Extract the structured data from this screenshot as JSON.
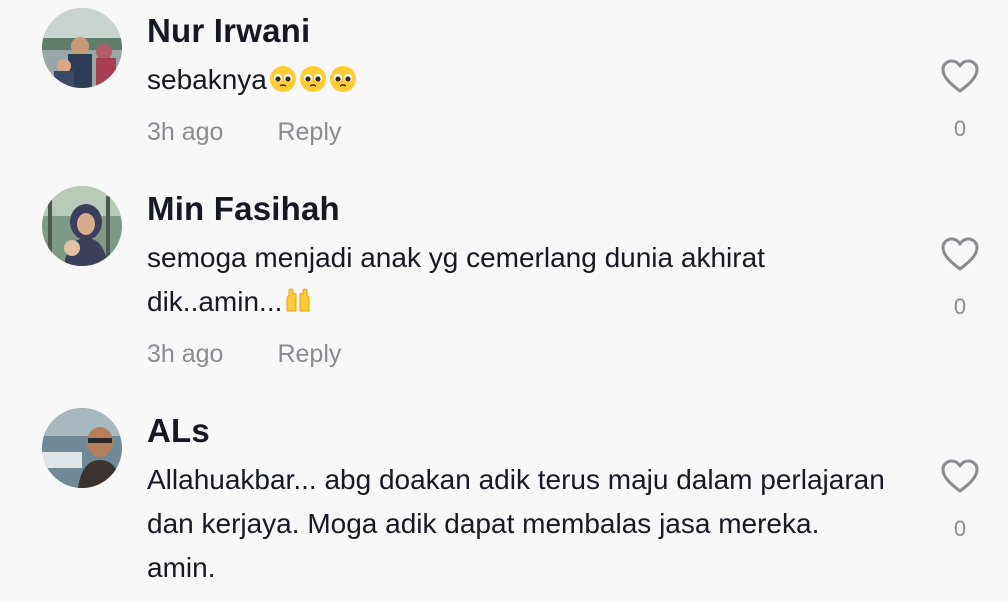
{
  "comments": [
    {
      "username": "Nur Irwani",
      "text": "sebaknya",
      "emoji": [
        "pleading-face",
        "pleading-face",
        "pleading-face"
      ],
      "time": "3h ago",
      "reply_label": "Reply",
      "likes": "0"
    },
    {
      "username": "Min Fasihah",
      "text": "semoga menjadi anak yg cemerlang dunia akhirat dik..amin...",
      "emoji": [
        "raising-hands"
      ],
      "time": "3h ago",
      "reply_label": "Reply",
      "likes": "0"
    },
    {
      "username": "ALs",
      "text": "Allahuakbar... abg doakan adik terus maju dalam perlajaran dan kerjaya. Moga adik dapat membalas jasa mereka. amin.",
      "emoji": [],
      "likes": "0"
    }
  ],
  "colors": {
    "background": "#f8f8f8",
    "text": "#161823",
    "muted": "#8a8b91",
    "emoji_yellow": "#ffcc33"
  },
  "icons": {
    "like": "heart-outline-icon"
  }
}
